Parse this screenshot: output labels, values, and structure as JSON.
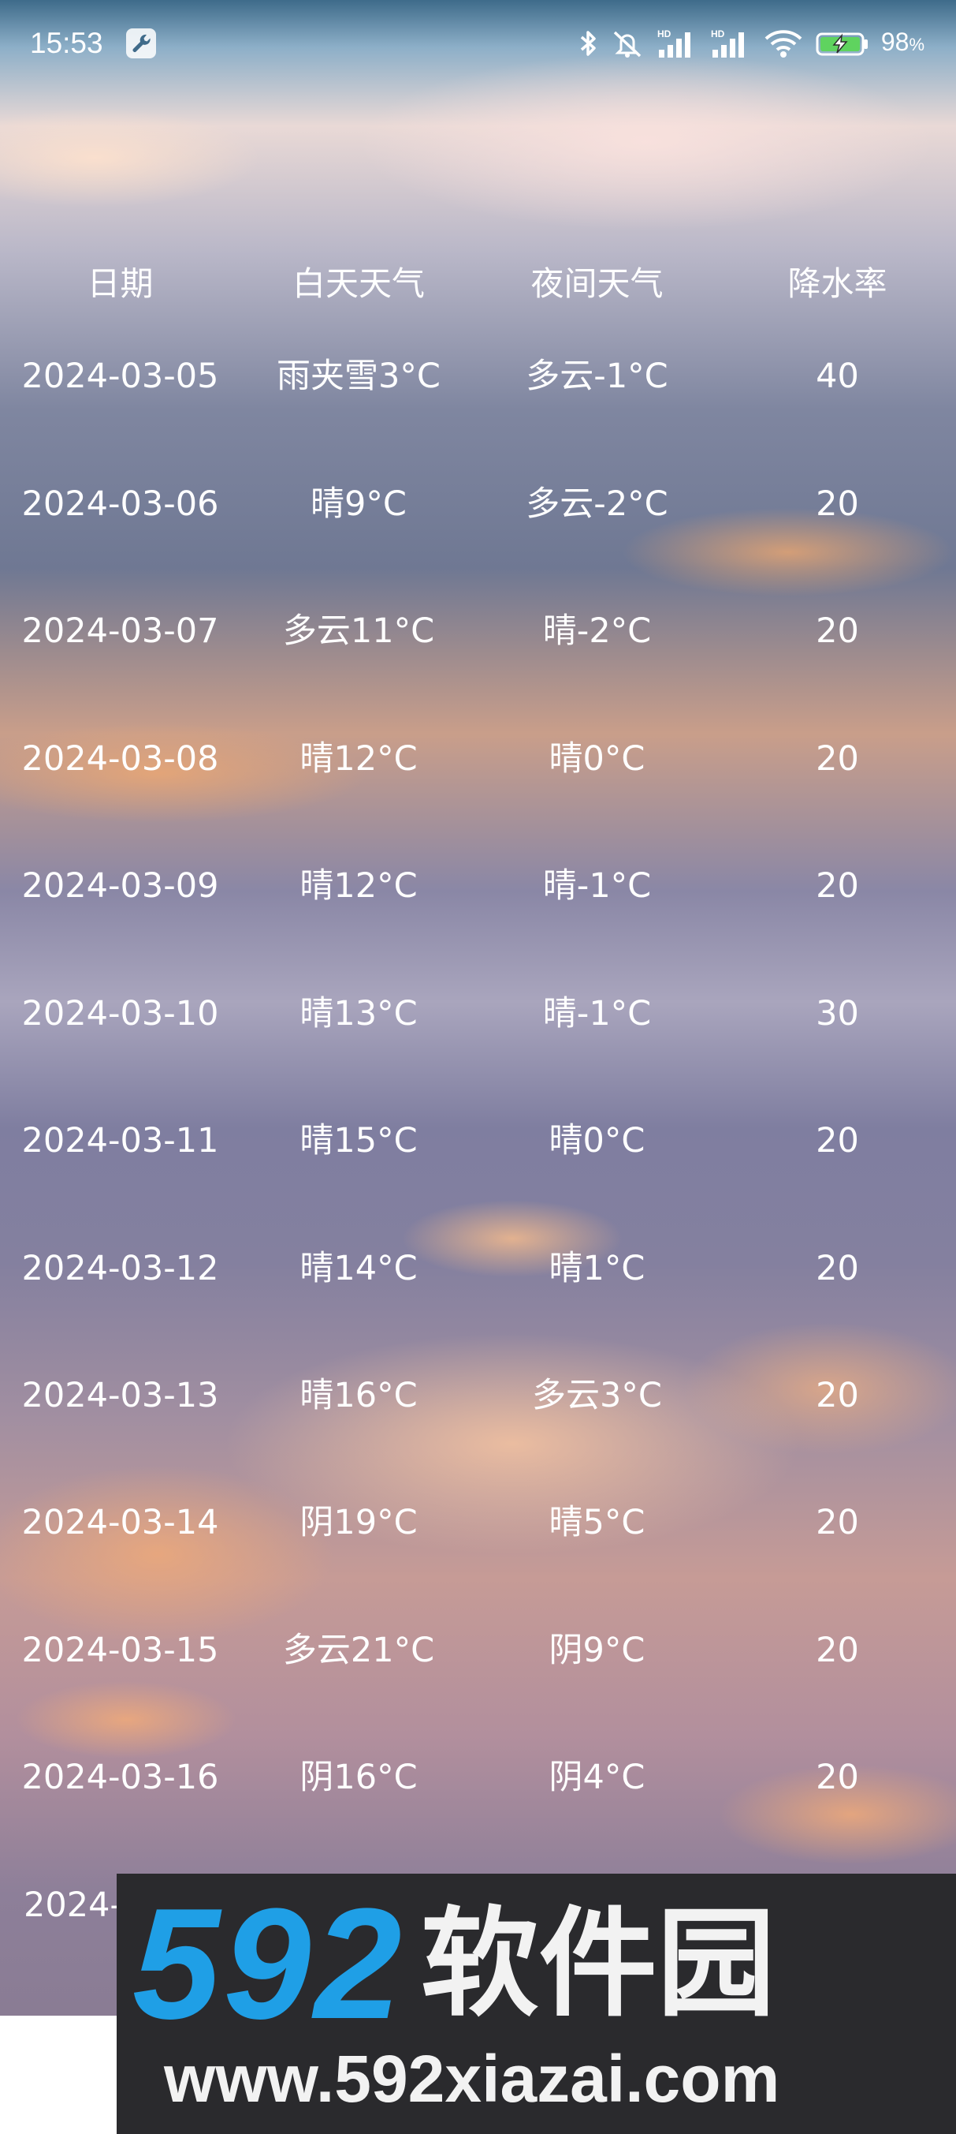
{
  "status_bar": {
    "time": "15:53",
    "battery_level": "98",
    "battery_unit": "%",
    "signal_labels": [
      "HD",
      "HD"
    ],
    "icons": [
      "wrench-icon",
      "bluetooth-icon",
      "mute-vibrate-icon",
      "cell-signal-icon",
      "cell-signal-icon",
      "wifi-icon",
      "battery-charging-icon"
    ]
  },
  "table": {
    "headers": {
      "date": "日期",
      "day_weather": "白天天气",
      "night_weather": "夜间天气",
      "precipitation": "降水率"
    },
    "rows": [
      {
        "date": "2024-03-05",
        "day": "雨夹雪3°C",
        "night": "多云-1°C",
        "rain": "40"
      },
      {
        "date": "2024-03-06",
        "day": "晴9°C",
        "night": "多云-2°C",
        "rain": "20"
      },
      {
        "date": "2024-03-07",
        "day": "多云11°C",
        "night": "晴-2°C",
        "rain": "20"
      },
      {
        "date": "2024-03-08",
        "day": "晴12°C",
        "night": "晴0°C",
        "rain": "20"
      },
      {
        "date": "2024-03-09",
        "day": "晴12°C",
        "night": "晴-1°C",
        "rain": "20"
      },
      {
        "date": "2024-03-10",
        "day": "晴13°C",
        "night": "晴-1°C",
        "rain": "30"
      },
      {
        "date": "2024-03-11",
        "day": "晴15°C",
        "night": "晴0°C",
        "rain": "20"
      },
      {
        "date": "2024-03-12",
        "day": "晴14°C",
        "night": "晴1°C",
        "rain": "20"
      },
      {
        "date": "2024-03-13",
        "day": "晴16°C",
        "night": "多云3°C",
        "rain": "20"
      },
      {
        "date": "2024-03-14",
        "day": "阴19°C",
        "night": "晴5°C",
        "rain": "20"
      },
      {
        "date": "2024-03-15",
        "day": "多云21°C",
        "night": "阴9°C",
        "rain": "20"
      },
      {
        "date": "2024-03-16",
        "day": "阴16°C",
        "night": "阴4°C",
        "rain": "20"
      }
    ],
    "partial_row_text": "2024-"
  },
  "watermark": {
    "logo_number": "592",
    "logo_text": "软件园",
    "url": "www.592xiazai.com",
    "number_color": "#1f9fe6"
  }
}
